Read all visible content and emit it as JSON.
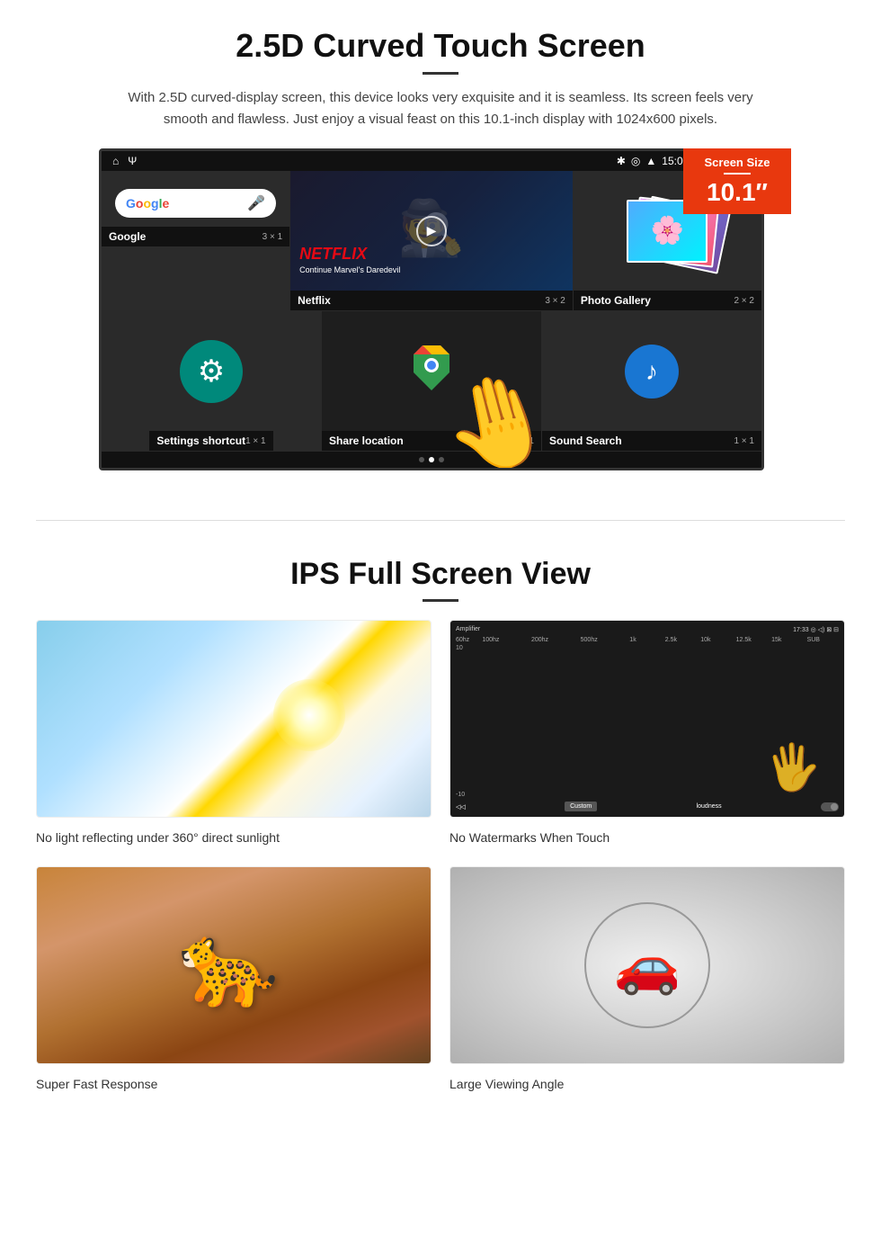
{
  "section1": {
    "title": "2.5D Curved Touch Screen",
    "description": "With 2.5D curved-display screen, this device looks very exquisite and it is seamless. Its screen feels very smooth and flawless. Just enjoy a visual feast on this 10.1-inch display with 1024x600 pixels.",
    "badge": {
      "label": "Screen Size",
      "size": "10.1″"
    },
    "statusBar": {
      "time": "15:06"
    },
    "apps": [
      {
        "name": "Google",
        "size": "3 × 1"
      },
      {
        "name": "Netflix",
        "size": "3 × 2"
      },
      {
        "name": "Photo Gallery",
        "size": "2 × 2"
      },
      {
        "name": "Settings shortcut",
        "size": "1 × 1"
      },
      {
        "name": "Share location",
        "size": "1 × 1"
      },
      {
        "name": "Sound Search",
        "size": "1 × 1"
      }
    ],
    "netflix": {
      "logo": "NETFLIX",
      "subtitle": "Continue Marvel's Daredevil"
    }
  },
  "section2": {
    "title": "IPS Full Screen View",
    "features": [
      {
        "id": "sunlight",
        "caption": "No light reflecting under 360° direct sunlight"
      },
      {
        "id": "amplifier",
        "caption": "No Watermarks When Touch"
      },
      {
        "id": "cheetah",
        "caption": "Super Fast Response"
      },
      {
        "id": "car",
        "caption": "Large Viewing Angle"
      }
    ]
  }
}
